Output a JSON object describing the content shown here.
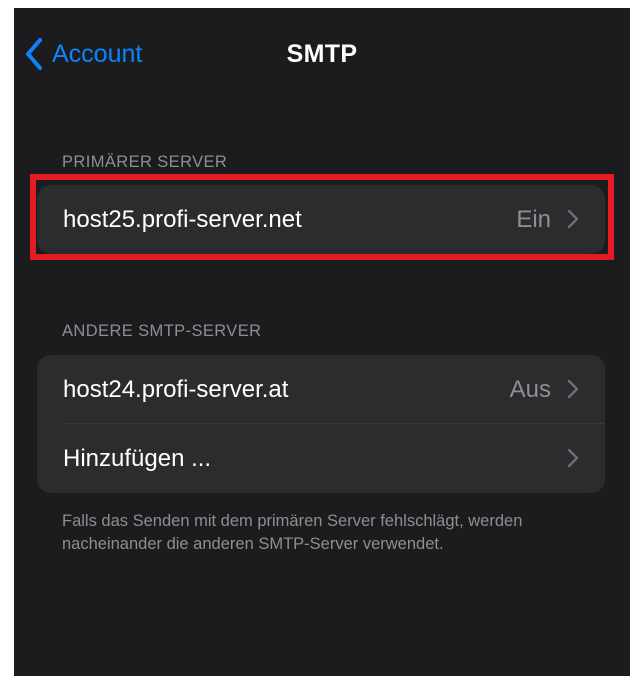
{
  "navbar": {
    "back_label": "Account",
    "title": "SMTP"
  },
  "primary_section": {
    "header": "PRIMÄRER SERVER",
    "rows": [
      {
        "label": "host25.profi-server.net",
        "value": "Ein"
      }
    ]
  },
  "other_section": {
    "header": "ANDERE SMTP-SERVER",
    "rows": [
      {
        "label": "host24.profi-server.at",
        "value": "Aus"
      },
      {
        "label": "Hinzufügen ...",
        "value": ""
      }
    ],
    "footer": "Falls das Senden mit dem primären Server fehlschlägt, werden nacheinander die anderen SMTP-Server verwendet."
  },
  "colors": {
    "background": "#1c1c1e",
    "cell": "#2c2c2e",
    "accent": "#0a84ff",
    "secondary_text": "#8e8e93",
    "highlight": "#e31b23"
  },
  "icons": {
    "back": "chevron-left-icon",
    "disclosure": "chevron-right-icon"
  }
}
